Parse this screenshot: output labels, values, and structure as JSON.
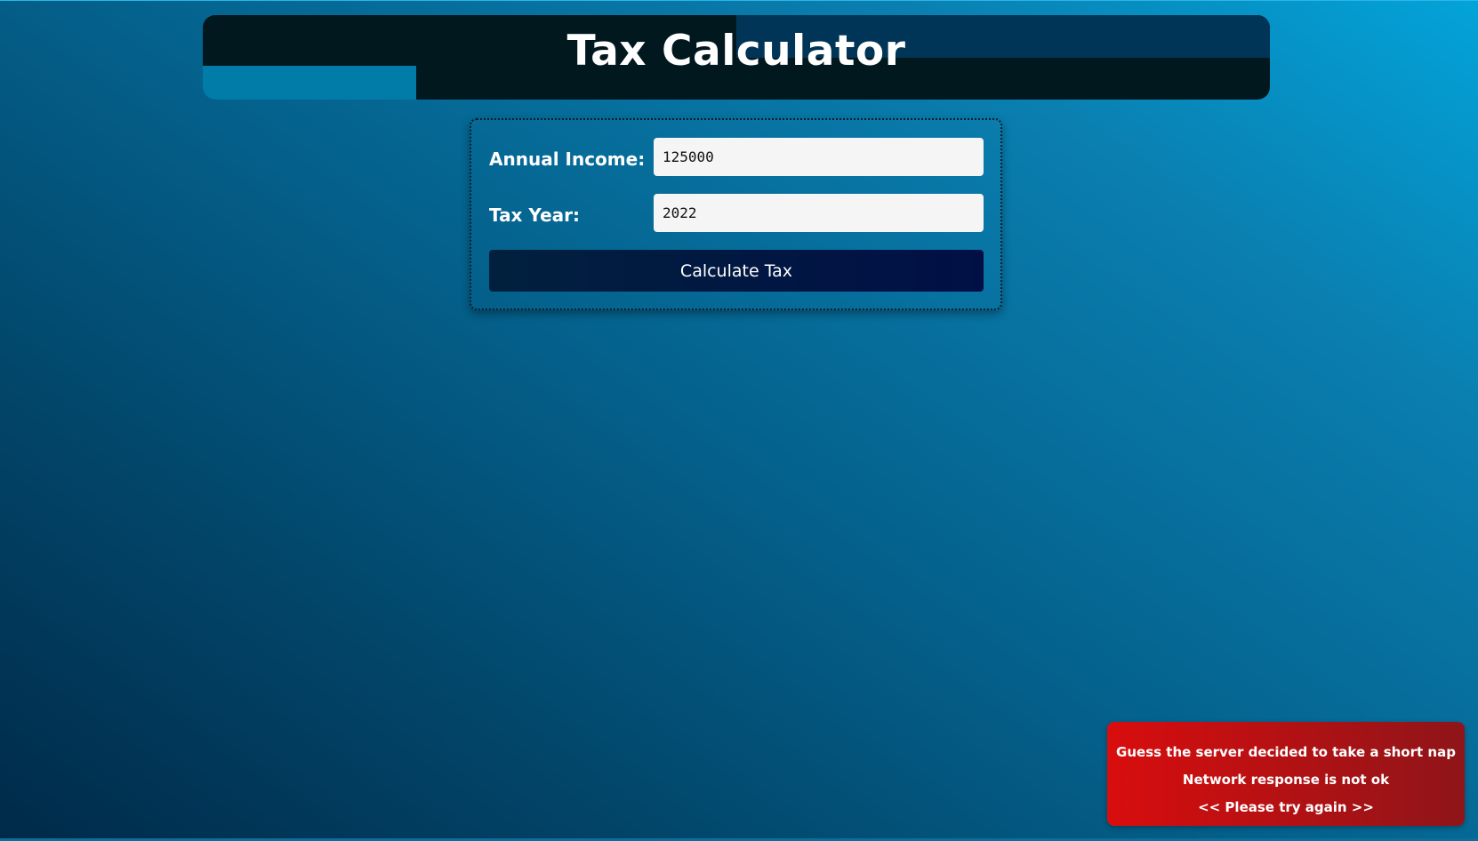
{
  "header": {
    "title": "Tax Calculator"
  },
  "form": {
    "income_label": "Annual Income:",
    "income_value": "125000",
    "year_label": "Tax Year:",
    "year_value": "2022",
    "submit_label": "Calculate Tax"
  },
  "error_toast": {
    "line1": "Guess the server decided to take a short nap",
    "line2": "Network response is not ok",
    "line3": "<< Please try again >>"
  },
  "colors": {
    "header_bg": "#01181f",
    "button_bg": "#011b45",
    "toast_bg": "#c8100f",
    "input_bg": "#f5f5f5"
  }
}
